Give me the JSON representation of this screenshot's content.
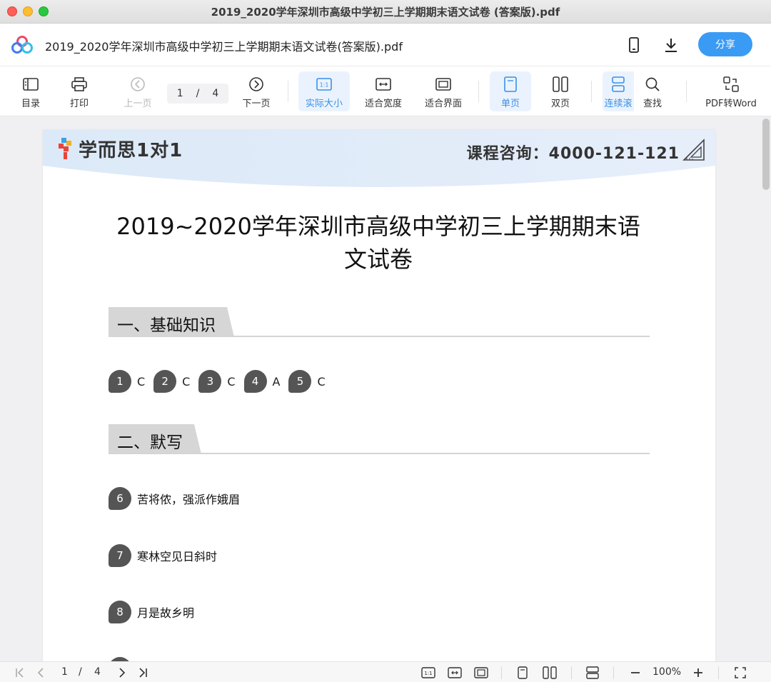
{
  "window": {
    "title": "2019_2020学年深圳市高级中学初三上学期期末语文试卷 (答案版).pdf"
  },
  "header": {
    "doc_name": "2019_2020学年深圳市高级中学初三上学期期末语文试卷(答案版).pdf",
    "share_label": "分享",
    "icons": [
      "phone-icon",
      "download-icon"
    ]
  },
  "toolbar": {
    "toc": "目录",
    "print": "打印",
    "prev": "上一页",
    "page_current": "1",
    "page_sep": "/",
    "page_total": "4",
    "next": "下一页",
    "actual_size": "实际大小",
    "fit_width": "适合宽度",
    "fit_screen": "适合界面",
    "single_page": "单页",
    "double_page": "双页",
    "continuous": "连续滚",
    "find": "查找",
    "pdf_to_word": "PDF转Word"
  },
  "document": {
    "brand": "学而思1对1",
    "hotline": "课程咨询：4000-121-121",
    "title_line1": "2019~2020学年深圳市高级中学初三上学期期末语",
    "title_line2": "文试卷",
    "section1": "一、基础知识",
    "section2": "二、默写",
    "mc_answers": [
      {
        "num": "1",
        "ans": "C"
      },
      {
        "num": "2",
        "ans": "C"
      },
      {
        "num": "3",
        "ans": "C"
      },
      {
        "num": "4",
        "ans": "A"
      },
      {
        "num": "5",
        "ans": "C"
      }
    ],
    "fill_answers": [
      {
        "num": "6",
        "text": "苦将侬，强派作娥眉"
      },
      {
        "num": "7",
        "text": "寒林空见日斜时"
      },
      {
        "num": "8",
        "text": "月是故乡明"
      }
    ]
  },
  "statusbar": {
    "page_current": "1",
    "page_sep": "/",
    "page_total": "4",
    "zoom": "100%"
  },
  "colors": {
    "accent": "#3a9bf5",
    "active_bg": "#eaf3fd",
    "bubble": "#555555"
  }
}
